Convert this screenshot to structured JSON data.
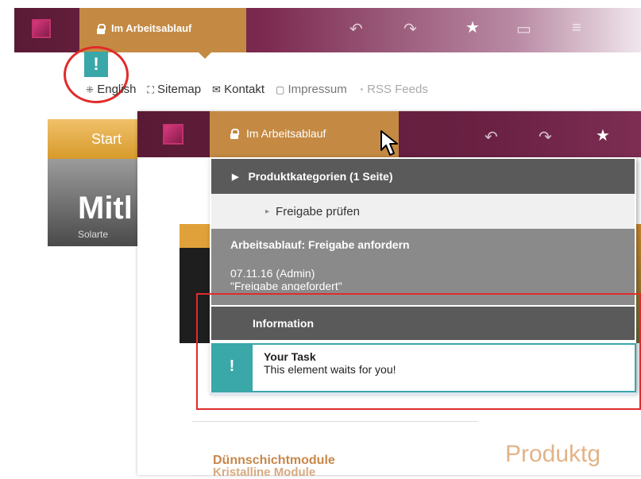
{
  "back": {
    "workflow_label": "Im Arbeitsablauf",
    "badge": "!",
    "nav_links": [
      {
        "label": "English",
        "icon": "language-icon"
      },
      {
        "label": "Sitemap",
        "icon": "sitemap-icon"
      },
      {
        "label": "Kontakt",
        "icon": "mail-icon"
      },
      {
        "label": "Impressum",
        "icon": "document-icon"
      },
      {
        "label": "RSS Feeds",
        "icon": "rss-icon"
      }
    ],
    "start_tab": "Start",
    "hero_title": "Mitl",
    "hero_sub": "Solarte"
  },
  "front": {
    "workflow_label": "Im Arbeitsablauf",
    "dropdown": {
      "category": "Produktkategorien (1 Seite)",
      "sub_item": "Freigabe prüfen",
      "workflow_title": "Arbeitsablauf: Freigabe anfordern",
      "date_line": "07.11.16 (Admin)",
      "status_line": "\"Freigabe angefordert\"",
      "section": "Information",
      "task_badge": "!",
      "task_title": "Your Task",
      "task_text": "This element waits for you!"
    },
    "sidebar": [
      "Dünnschichtmodule",
      "Kristalline Module"
    ],
    "page_heading": "Produktg"
  },
  "colors": {
    "brand": "#5a1a35",
    "workflow_tab": "#c48a43",
    "teal": "#3aa7a9",
    "highlight": "#e02b2b"
  }
}
